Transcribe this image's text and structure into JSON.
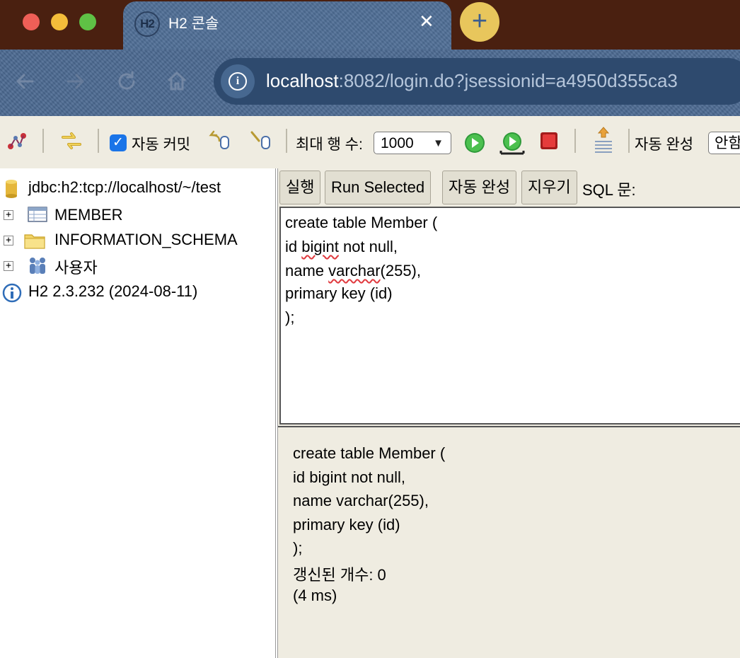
{
  "browser": {
    "tab_title": "H2 콘솔",
    "tab_icon_text": "H2",
    "close_glyph": "✕",
    "newtab_glyph": "+",
    "url_host": "localhost",
    "url_rest": ":8082/login.do?jsessionid=a4950d355ca3",
    "icons": [
      "back-icon",
      "forward-icon",
      "reload-icon",
      "home-icon",
      "site-info-icon"
    ]
  },
  "toolbar": {
    "auto_commit_label": "자동 커밋",
    "auto_commit_checked": true,
    "max_rows_label": "최대 행 수:",
    "max_rows_value": "1000",
    "autocomplete_label": "자동 완성",
    "autocomplete_value": "안함",
    "icons": [
      "disconnect-icon",
      "refresh-icon",
      "rollback-icon",
      "commit-icon",
      "run-icon",
      "run-selected-icon",
      "stop-icon",
      "history-icon"
    ]
  },
  "tree": {
    "connection": "jdbc:h2:tcp://localhost/~/test",
    "items": [
      {
        "label": "MEMBER",
        "icon": "table-icon"
      },
      {
        "label": "INFORMATION_SCHEMA",
        "icon": "folder-icon"
      },
      {
        "label": "사용자",
        "icon": "users-icon"
      }
    ],
    "version": "H2 2.3.232 (2024-08-11)"
  },
  "actions": {
    "run": "실행",
    "run_selected": "Run Selected",
    "autocomplete": "자동 완성",
    "clear": "지우기",
    "sql_label": "SQL 문:"
  },
  "editor": {
    "line1": "create table Member (",
    "line2_pre": "id ",
    "line2_err": "bigint",
    "line2_post": " not null,",
    "line3_pre": "name ",
    "line3_err": "varchar",
    "line3_post": "(255),",
    "line4": "primary key (id)",
    "line5": ");"
  },
  "result": {
    "lines": [
      "create table Member (",
      "id bigint not null,",
      "name varchar(255),",
      "primary key (id)",
      ");",
      "갱신된 개수: 0",
      "(4 ms)"
    ]
  }
}
